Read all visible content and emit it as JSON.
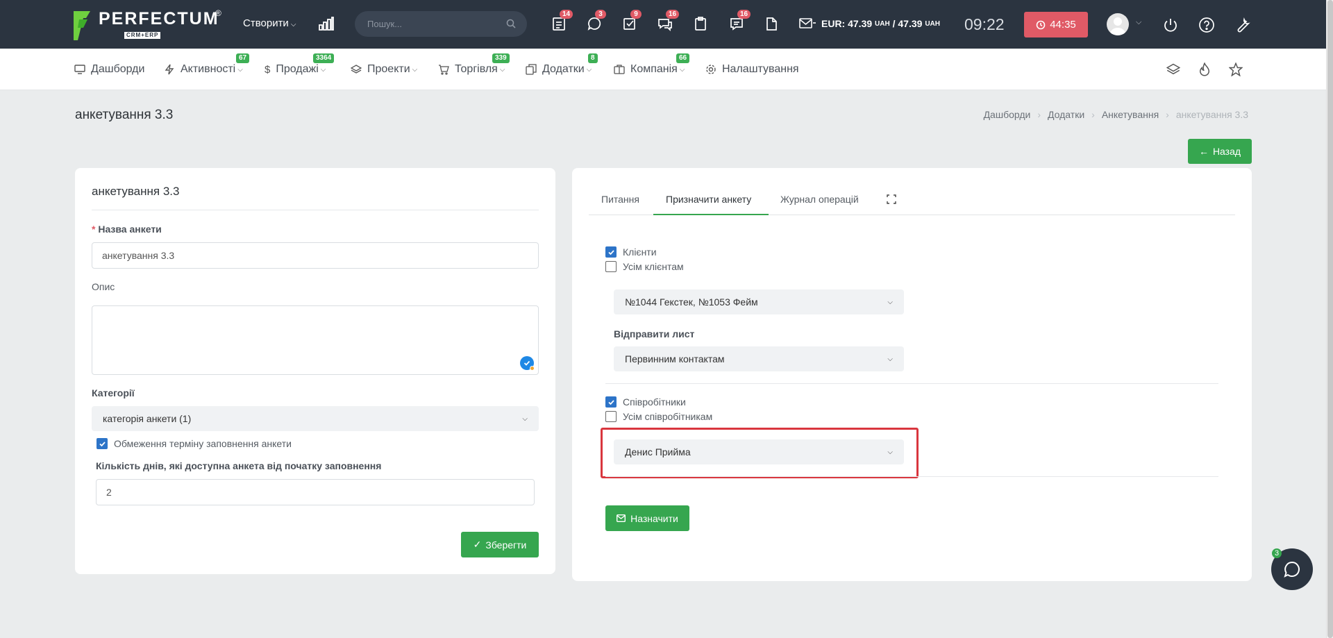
{
  "topbar": {
    "logo_text": "PERFECTUM",
    "logo_sub": "CRM+ERP",
    "logo_reg": "®",
    "create_label": "Створити",
    "search_placeholder": "Пошук...",
    "badges": [
      "14",
      "3",
      "9",
      "16",
      "16"
    ],
    "currency_label": "EUR: 47.39",
    "currency_unit": "UAH",
    "currency_label2": "/ 47.39",
    "clock": "09:22",
    "timer": "44:35"
  },
  "nav": {
    "items": [
      {
        "label": "Дашборди",
        "icon": "monitor-icon"
      },
      {
        "label": "Активності",
        "icon": "bolt-icon",
        "badge": "67"
      },
      {
        "label": "Продажі",
        "icon": "dollar-icon",
        "badge": "3364"
      },
      {
        "label": "Проекти",
        "icon": "layers-icon"
      },
      {
        "label": "Торгівля",
        "icon": "cart-icon",
        "badge": "339"
      },
      {
        "label": "Додатки",
        "icon": "copy-icon",
        "badge": "8"
      },
      {
        "label": "Компанія",
        "icon": "briefcase-icon",
        "badge": "66"
      },
      {
        "label": "Налаштування",
        "icon": "gear-icon"
      }
    ]
  },
  "page": {
    "title": "анкетування 3.3",
    "breadcrumb": [
      "Дашборди",
      "Додатки",
      "Анкетування",
      "анкетування 3.3"
    ],
    "back_label": "Назад"
  },
  "form": {
    "card_title": "анкетування 3.3",
    "name_label": "Назва анкети",
    "name_value": "анкетування 3.3",
    "desc_label": "Опис",
    "category_label": "Категорії",
    "category_value": "категорія анкети (1)",
    "limit_label": "Обмеження терміну заповнення анкети",
    "limit_checked": true,
    "days_label": "Кількість днів, які доступна анкета від початку заповнення",
    "days_value": "2",
    "save_label": "Зберегти"
  },
  "assign": {
    "tabs": [
      "Питання",
      "Призначити анкету",
      "Журнал операцій"
    ],
    "active_tab": 1,
    "clients_label": "Клієнти",
    "clients_checked": true,
    "all_clients_label": "Усім клієнтам",
    "all_clients_checked": false,
    "clients_select": "№1044 Гекстек, №1053 Фейм",
    "send_label": "Відправити лист",
    "send_select": "Первинним контактам",
    "employees_label": "Співробітники",
    "employees_checked": true,
    "all_employees_label": "Усім співробітникам",
    "all_employees_checked": false,
    "employees_select": "Денис Прийма",
    "assign_label": "Назначити"
  },
  "chat": {
    "badge": "3"
  },
  "colors": {
    "green": "#36a64f",
    "red": "#e05a66",
    "dark": "#2b3440",
    "blue": "#2d74c8",
    "highlight": "#d9363e"
  }
}
